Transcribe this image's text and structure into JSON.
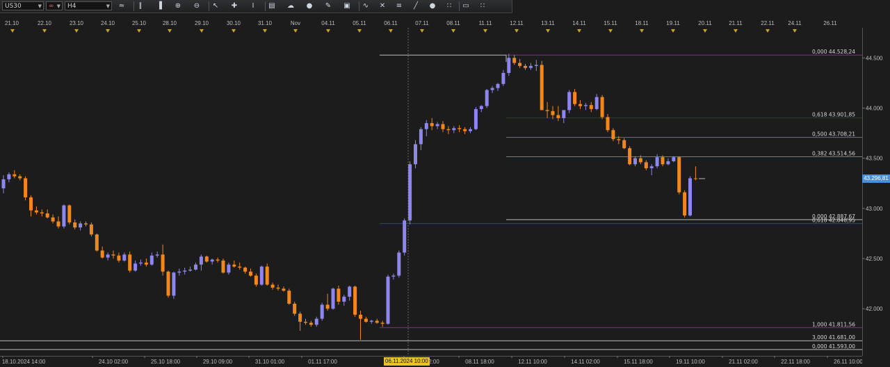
{
  "toolbar": {
    "symbol": "US30",
    "symbol_dropdown_icon": "chevron-down-icon",
    "link_icon": "chain-link-icon",
    "timeframe": "H4",
    "tools": [
      "chart-type-icon",
      "bar-chart-icon",
      "candle-chart-icon",
      "zoom-in-icon",
      "zoom-out-icon",
      "cursor-icon",
      "crosshair-icon",
      "text-cursor-icon",
      "note-icon",
      "cloud-icon",
      "globe-icon",
      "pencil-icon",
      "screen-icon",
      "indicator-icon",
      "pattern-icon",
      "fib-icon",
      "trend-icon",
      "circle-icon",
      "dots-icon",
      "eraser-icon",
      "grid-icon"
    ]
  },
  "top_time_labels": [
    "21.10",
    "22.10",
    "23.10",
    "24.10",
    "25.10",
    "28.10",
    "29.10",
    "30.10",
    "31.10",
    "Nov",
    "04.11",
    "05.11",
    "06.11",
    "07.11",
    "08.11",
    "11.11",
    "12.11",
    "13.11",
    "14.11",
    "15.11",
    "18.11",
    "19.11",
    "20.11",
    "21.11",
    "22.11",
    "24.11",
    "26.11"
  ],
  "bottom_time_labels": [
    "18.10.2024 14:00",
    "24.10 02:00",
    "25.10 18:00",
    "29.10 09:00",
    "31.10 01:00",
    "01.11 17:00",
    "05.11 10:00",
    "07.11 02:00",
    "08.11 18:00",
    "12.11 10:00",
    "14.11 02:00",
    "15.11 18:00",
    "19.11 10:00",
    "21.11 02:00",
    "22.11 18:00",
    "26.11 10:00"
  ],
  "cursor_time_label": "06.11.2024 10:00",
  "price_axis_labels": [
    "44.500",
    "44.000",
    "43.500",
    "43.000",
    "42.500",
    "42.000"
  ],
  "current_price": "43.296,81",
  "colors": {
    "background": "#1c1c1c",
    "bull_candle": "#8c86ee",
    "bear_candle": "#f2871c",
    "current_price_tag": "#4a90d9",
    "cursor_tag": "#e8c428"
  },
  "fib_levels": [
    {
      "label": "0,000 44.528,24",
      "price": 44528.24,
      "color": "#8a2d8a"
    },
    {
      "label": "0,618 43.901,85",
      "price": 43901.85,
      "color": "#28289c"
    },
    {
      "label": "0,500 43.708,21",
      "price": 43708.21,
      "color": "#2aa32a"
    },
    {
      "label": "0,382 43.514,56",
      "price": 43514.56,
      "color": "#c8641e"
    },
    {
      "label": "0,000 42.887,67",
      "price": 42887.67,
      "color": "#bbbbbb"
    },
    {
      "label": "0,618 42.848,95",
      "price": 42848.95,
      "color": "#2e3ea8"
    },
    {
      "label": "1,000 41.811,56",
      "price": 41811.56,
      "color": "#8a2d8a"
    },
    {
      "label": "3,000 41.681,00",
      "price": 41681.0,
      "color": "#bbbbbb"
    },
    {
      "label": "0,000 41.593,00",
      "price": 41593.0,
      "color": "#bbbbbb"
    }
  ],
  "chart_data": {
    "type": "candlestick",
    "symbol": "US30",
    "timeframe": "H4",
    "ylim": [
      41530,
      44800
    ],
    "y_ticks": [
      42000,
      42500,
      43000,
      43500,
      44000,
      44500
    ],
    "series": [
      {
        "values": [
          [
            43200,
            43330,
            43150,
            43290
          ],
          [
            43290,
            43360,
            43260,
            43340
          ],
          [
            43340,
            43380,
            43300,
            43320
          ],
          [
            43320,
            43340,
            43280,
            43300
          ],
          [
            43300,
            43320,
            43080,
            43110
          ],
          [
            43110,
            43130,
            42920,
            42980
          ],
          [
            42980,
            43020,
            42940,
            42960
          ],
          [
            42960,
            42990,
            42920,
            42950
          ],
          [
            42950,
            42990,
            42900,
            42910
          ],
          [
            42910,
            42940,
            42850,
            42870
          ],
          [
            42870,
            42920,
            42800,
            42820
          ],
          [
            42820,
            43040,
            42800,
            43030
          ],
          [
            43030,
            43040,
            42840,
            42860
          ],
          [
            42860,
            42890,
            42790,
            42810
          ],
          [
            42810,
            42870,
            42780,
            42850
          ],
          [
            42850,
            42870,
            42820,
            42840
          ],
          [
            42840,
            42860,
            42720,
            42740
          ],
          [
            42740,
            42750,
            42570,
            42580
          ],
          [
            42580,
            42620,
            42500,
            42510
          ],
          [
            42510,
            42560,
            42480,
            42540
          ],
          [
            42540,
            42580,
            42500,
            42530
          ],
          [
            42530,
            42560,
            42460,
            42480
          ],
          [
            42480,
            42560,
            42470,
            42540
          ],
          [
            42540,
            42570,
            42360,
            42380
          ],
          [
            42380,
            42480,
            42370,
            42450
          ],
          [
            42450,
            42490,
            42430,
            42460
          ],
          [
            42460,
            42500,
            42420,
            42440
          ],
          [
            42440,
            42560,
            42430,
            42530
          ],
          [
            42530,
            42570,
            42510,
            42540
          ],
          [
            42540,
            42640,
            42330,
            42370
          ],
          [
            42370,
            42380,
            42110,
            42130
          ],
          [
            42130,
            42370,
            42100,
            42360
          ],
          [
            42360,
            42400,
            42330,
            42370
          ],
          [
            42370,
            42410,
            42340,
            42380
          ],
          [
            42380,
            42420,
            42370,
            42390
          ],
          [
            42390,
            42460,
            42380,
            42440
          ],
          [
            42440,
            42540,
            42380,
            42520
          ],
          [
            42520,
            42530,
            42460,
            42470
          ],
          [
            42470,
            42500,
            42440,
            42490
          ],
          [
            42490,
            42510,
            42460,
            42480
          ],
          [
            42480,
            42500,
            42350,
            42360
          ],
          [
            42360,
            42460,
            42340,
            42440
          ],
          [
            42440,
            42480,
            42410,
            42420
          ],
          [
            42420,
            42460,
            42390,
            42410
          ],
          [
            42410,
            42420,
            42350,
            42370
          ],
          [
            42370,
            42400,
            42320,
            42330
          ],
          [
            42330,
            42350,
            42220,
            42240
          ],
          [
            42240,
            42430,
            42230,
            42420
          ],
          [
            42420,
            42450,
            42230,
            42240
          ],
          [
            42240,
            42260,
            42190,
            42210
          ],
          [
            42210,
            42240,
            42180,
            42200
          ],
          [
            42200,
            42220,
            42170,
            42180
          ],
          [
            42180,
            42200,
            42040,
            42050
          ],
          [
            42050,
            42070,
            41930,
            41950
          ],
          [
            41950,
            41970,
            41780,
            41870
          ],
          [
            41870,
            41900,
            41840,
            41860
          ],
          [
            41860,
            41880,
            41820,
            41840
          ],
          [
            41840,
            41920,
            41820,
            41900
          ],
          [
            41900,
            42060,
            41880,
            42040
          ],
          [
            42040,
            42150,
            41980,
            42000
          ],
          [
            42000,
            42210,
            41990,
            42200
          ],
          [
            42200,
            42230,
            42040,
            42070
          ],
          [
            42070,
            42140,
            42030,
            42120
          ],
          [
            42120,
            42230,
            42080,
            42220
          ],
          [
            42220,
            42230,
            41920,
            41940
          ],
          [
            41940,
            41980,
            41690,
            41900
          ],
          [
            41900,
            41920,
            41860,
            41870
          ],
          [
            41870,
            41890,
            41850,
            41880
          ],
          [
            41880,
            41900,
            41850,
            41860
          ],
          [
            41860,
            41880,
            41820,
            41850
          ],
          [
            41850,
            42340,
            41840,
            42320
          ],
          [
            42320,
            42350,
            42290,
            42330
          ],
          [
            42330,
            42580,
            42310,
            42560
          ],
          [
            42560,
            42900,
            42530,
            42880
          ],
          [
            42880,
            43470,
            42840,
            43440
          ],
          [
            43440,
            43680,
            43400,
            43640
          ],
          [
            43640,
            43810,
            43580,
            43790
          ],
          [
            43790,
            43880,
            43720,
            43850
          ],
          [
            43850,
            43900,
            43780,
            43820
          ],
          [
            43820,
            43860,
            43790,
            43840
          ],
          [
            43840,
            43870,
            43760,
            43790
          ],
          [
            43790,
            43820,
            43740,
            43780
          ],
          [
            43780,
            43820,
            43750,
            43800
          ],
          [
            43800,
            43830,
            43760,
            43790
          ],
          [
            43790,
            43810,
            43740,
            43770
          ],
          [
            43770,
            43810,
            43750,
            43790
          ],
          [
            43790,
            44010,
            43780,
            43990
          ],
          [
            43990,
            44030,
            43960,
            44020
          ],
          [
            44020,
            44190,
            44000,
            44180
          ],
          [
            44180,
            44220,
            44150,
            44200
          ],
          [
            44200,
            44250,
            44170,
            44240
          ],
          [
            44240,
            44380,
            44220,
            44350
          ],
          [
            44350,
            44540,
            44320,
            44500
          ],
          [
            44500,
            44530,
            44430,
            44450
          ],
          [
            44450,
            44490,
            44400,
            44420
          ],
          [
            44420,
            44440,
            44380,
            44400
          ],
          [
            44400,
            44450,
            44380,
            44420
          ],
          [
            44420,
            44480,
            44370,
            44430
          ],
          [
            44430,
            44470,
            43980,
            43980
          ],
          [
            43980,
            44060,
            43900,
            43970
          ],
          [
            43970,
            44020,
            43890,
            43930
          ],
          [
            43930,
            44020,
            43870,
            43900
          ],
          [
            43900,
            43980,
            43850,
            43980
          ],
          [
            43980,
            44180,
            43950,
            44160
          ],
          [
            44160,
            44190,
            44020,
            44040
          ],
          [
            44040,
            44080,
            43990,
            44020
          ],
          [
            44020,
            44050,
            43980,
            44030
          ],
          [
            44030,
            44060,
            43960,
            43990
          ],
          [
            43990,
            44140,
            43980,
            44110
          ],
          [
            44110,
            44130,
            43890,
            43910
          ],
          [
            43910,
            43940,
            43760,
            43780
          ],
          [
            43780,
            43800,
            43670,
            43690
          ],
          [
            43690,
            43720,
            43640,
            43680
          ],
          [
            43680,
            43700,
            43590,
            43600
          ],
          [
            43600,
            43620,
            43430,
            43440
          ],
          [
            43440,
            43520,
            43420,
            43500
          ],
          [
            43500,
            43530,
            43440,
            43460
          ],
          [
            43460,
            43480,
            43380,
            43400
          ],
          [
            43400,
            43440,
            43330,
            43420
          ],
          [
            43420,
            43540,
            43400,
            43510
          ],
          [
            43510,
            43530,
            43420,
            43440
          ],
          [
            43440,
            43500,
            43430,
            43470
          ],
          [
            43470,
            43520,
            43460,
            43510
          ],
          [
            43510,
            43520,
            43140,
            43160
          ],
          [
            43160,
            43180,
            42910,
            42930
          ],
          [
            42930,
            43320,
            42920,
            43300
          ],
          [
            43300,
            43420,
            43280,
            43297
          ]
        ]
      }
    ]
  }
}
